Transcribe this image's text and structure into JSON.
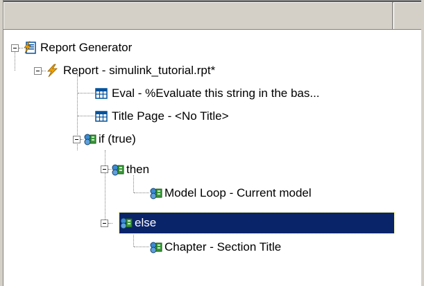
{
  "tree": {
    "items": [
      {
        "label": "Report Generator",
        "icon": "report-generator-icon"
      },
      {
        "label": "Report - simulink_tutorial.rpt*",
        "icon": "lightning-icon"
      },
      {
        "label": "Eval - %Evaluate this string in the bas...",
        "icon": "table-grid-icon"
      },
      {
        "label": "Title Page - <No Title>",
        "icon": "table-grid-icon"
      },
      {
        "label": "if (true)",
        "icon": "logic-component-icon"
      },
      {
        "label": "then",
        "icon": "logic-component-icon"
      },
      {
        "label": "Model Loop - Current model",
        "icon": "logic-component-icon"
      },
      {
        "label": "else",
        "icon": "logic-component-icon",
        "selected": true
      },
      {
        "label": "Chapter - Section Title",
        "icon": "logic-component-icon"
      }
    ]
  },
  "colors": {
    "selection": "#0a246a",
    "header": "#d4d0c8",
    "lightning": "#f0a000"
  }
}
